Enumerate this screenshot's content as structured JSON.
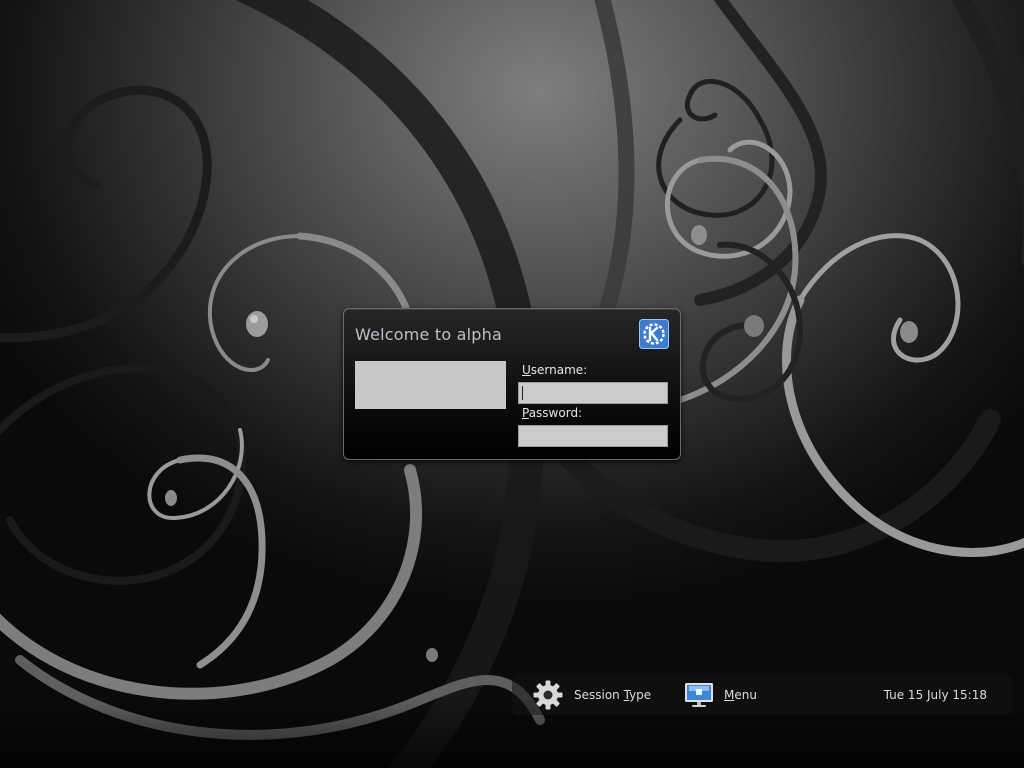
{
  "dialog": {
    "welcome": "Welcome to alpha",
    "username_label": {
      "accel": "U",
      "rest": "sername:"
    },
    "password_label": {
      "accel": "P",
      "rest": "assword:"
    },
    "username_value": "",
    "password_value": ""
  },
  "bottom_bar": {
    "session_type": {
      "pre": "Session ",
      "accel": "T",
      "post": "ype",
      "icon": "gear-icon"
    },
    "menu": {
      "accel": "M",
      "post": "enu",
      "icon": "monitor-icon"
    },
    "clock": "Tue 15 July 15:18"
  },
  "colors": {
    "dialog_title": "#b9c2cc",
    "field_background": "#cbcbcb",
    "kde_logo": "#3b7bd0"
  }
}
